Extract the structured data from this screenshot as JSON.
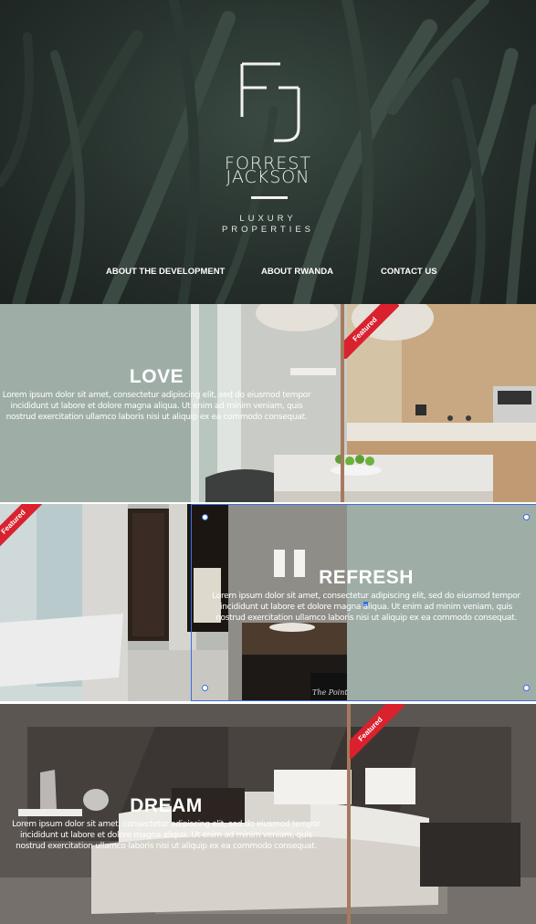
{
  "brand": {
    "name_line1": "FORREST",
    "name_line2": "JACKSON",
    "sub_line1": "LUXURY",
    "sub_line2": "PROPERTIES",
    "logo_icon": "fj-monogram-icon"
  },
  "nav": {
    "items": [
      {
        "label": "ABOUT THE DEVELOPMENT"
      },
      {
        "label": "ABOUT RWANDA"
      },
      {
        "label": "CONTACT US"
      }
    ]
  },
  "sections": [
    {
      "title": "LOVE",
      "body": "Lorem ipsum dolor sit amet, consectetur adipiscing elit, sed do eiusmod tempor incididunt ut labore et dolore magna aliqua. Ut enim ad minim veniam, quis nostrud exercitation ullamco laboris nisi ut aliquip ex ea commodo consequat.",
      "badge": "Featured"
    },
    {
      "title": "REFRESH",
      "body": "Lorem ipsum dolor sit amet, consectetur adipiscing elit, sed do eiusmod tempor incididunt ut labore et dolore magna aliqua. Ut enim ad minim veniam, quis nostrud exercitation ullamco laboris nisi ut aliquip ex ea commodo consequat.",
      "badge": "Featured",
      "image_caption": "The Point"
    },
    {
      "title": "DREAM",
      "body": "Lorem ipsum dolor sit amet, consectetur adipiscing elit, sed do eiusmod tempor incididunt ut labore et dolore magna aliqua. Ut enim ad minim veniam, quis nostrud exercitation ullamco laboris nisi ut aliquip ex ea commodo consequat.",
      "badge": "Featured"
    }
  ],
  "colors": {
    "panel": "#9fada7",
    "badge": "#d9222e",
    "divider": "#a67a5e",
    "selection": "#3b6fe0"
  }
}
